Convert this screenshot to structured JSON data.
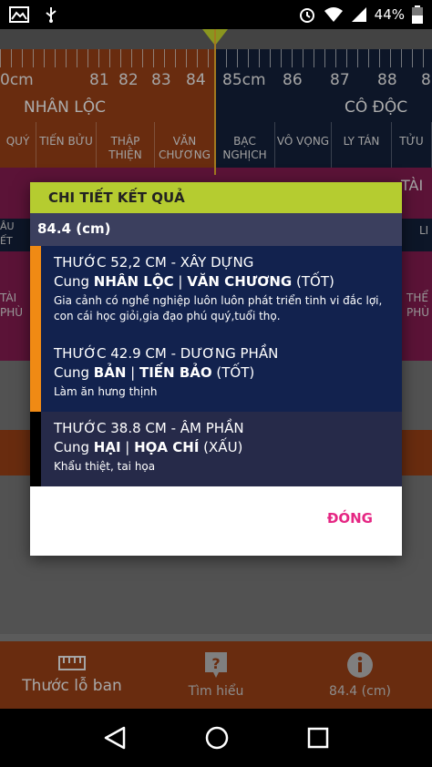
{
  "status": {
    "battery": "44%"
  },
  "ruler": {
    "left_ticks": [
      "0cm",
      "81",
      "82",
      "83",
      "84"
    ],
    "right_ticks": [
      "85cm",
      "86",
      "87",
      "88",
      "8"
    ],
    "left_palace": "NHÂN LỘC",
    "right_palace": "CÔ ĐỘC",
    "left_subs": [
      "QUÝ",
      "TIẾN BỬU",
      "THẬP THIỆN",
      "VĂN CHƯƠNG"
    ],
    "right_subs": [
      "BẠC NGHỊCH",
      "VÔ VỌNG",
      "LY TÁN",
      "TỬU"
    ],
    "partial_labels": {
      "left_a": "ÂU",
      "left_b": "ẾT",
      "right_a": "TÀI",
      "right_b": "LI",
      "left_c": "TÀI",
      "left_d": "PHÙ",
      "right_c": "THỂ",
      "right_d": "PHÙ"
    }
  },
  "dialog": {
    "title": "CHI TIẾT KẾT QUẢ",
    "measure": "84.4 (cm)",
    "items": [
      {
        "title": "THƯỚC 52,2 CM - XÂY DỰNG",
        "cung_prefix": "Cung ",
        "cung_a": "NHÂN LỘC",
        "sep": " | ",
        "cung_b": "VĂN CHƯƠNG",
        "verdict": " (TỐT)",
        "desc": "Gia cảnh có nghề nghiệp luôn luôn phát triển tinh vi đắc lợi, con cái học giỏi,gia đạo phú quý,tuổi thọ.",
        "accent": "#f08a14"
      },
      {
        "title": "THƯỚC 42.9 CM - DƯƠNG PHẦN",
        "cung_prefix": "Cung ",
        "cung_a": "BẢN",
        "sep": " | ",
        "cung_b": "TIẾN BẢO",
        "verdict": " (TỐT)",
        "desc": "Làm ăn hưng thịnh",
        "accent": "#f08a14"
      },
      {
        "title": "THƯỚC 38.8 CM - ÂM PHẦN",
        "cung_prefix": "Cung ",
        "cung_a": "HẠI",
        "sep": " | ",
        "cung_b": "HỌA CHÍ",
        "verdict": " (XẤU)",
        "desc": "Khẩu thiệt, tai họa",
        "accent": "#000000"
      }
    ],
    "close_label": "ĐÓNG"
  },
  "bottom_nav": [
    {
      "label": "Thước lỗ ban",
      "icon": "ruler-icon"
    },
    {
      "label": "Tìm hiểu",
      "icon": "question-icon"
    },
    {
      "label": "84.4 (cm)",
      "icon": "info-icon"
    }
  ],
  "colors": {
    "accent": "#b5cc30",
    "close": "#e52683",
    "orange": "#8d3b14",
    "navy": "#12224e"
  }
}
